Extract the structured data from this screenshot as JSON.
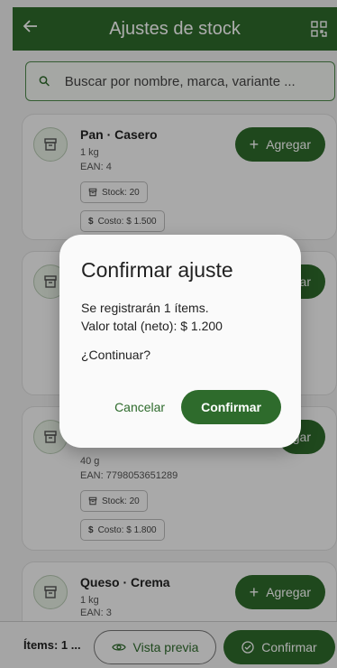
{
  "appbar": {
    "title": "Ajustes de stock",
    "back_icon": "arrow-left-icon",
    "scan_icon": "qr-scan-icon",
    "bg_color": "#2e6b2c"
  },
  "search": {
    "placeholder": "Buscar por nombre, marca, variante ...",
    "icon": "search-icon"
  },
  "products": [
    {
      "name": "Pan · Casero",
      "unit": "1 kg",
      "ean": "EAN: 4",
      "stock": "Stock: 20",
      "cost": "Costo: $ 1.500",
      "add_label": "Agregar"
    },
    {
      "add_label": "gar"
    },
    {
      "unit": "40 g",
      "ean": "EAN: 7798053651289",
      "stock": "Stock: 20",
      "cost": "Costo: $ 1.800",
      "add_label": "gar"
    },
    {
      "name": "Queso · Crema",
      "unit": "1 kg",
      "ean": "EAN: 3",
      "add_label": "Agregar"
    }
  ],
  "bottom": {
    "items_label": "Ítems: 1 ...",
    "preview_label": "Vista previa",
    "confirm_label": "Confirmar"
  },
  "dialog": {
    "title": "Confirmar ajuste",
    "line1": "Se registrarán 1 ítems.",
    "line2": "Valor total (neto): $ 1.200",
    "question": "¿Continuar?",
    "cancel": "Cancelar",
    "confirm": "Confirmar"
  }
}
